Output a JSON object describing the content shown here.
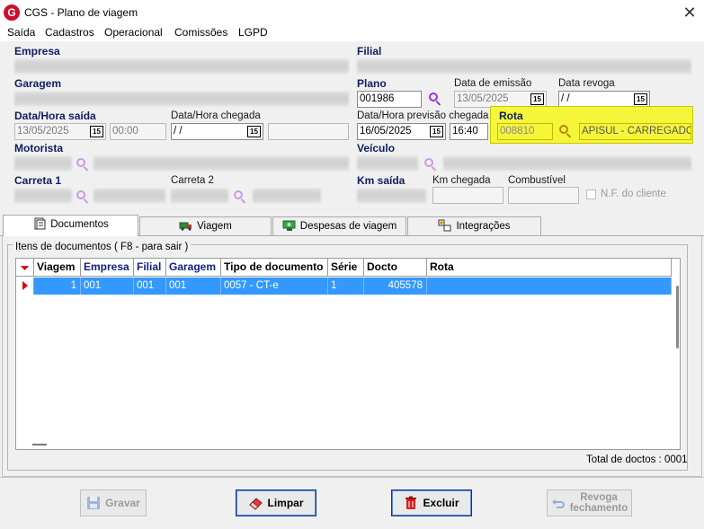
{
  "window": {
    "title": "CGS - Plano de viagem",
    "icon_letter": "G"
  },
  "menu": [
    "Saída",
    "Cadastros",
    "Operacional",
    "Comissões",
    "LGPD"
  ],
  "labels": {
    "empresa": "Empresa",
    "filial": "Filial",
    "garagem": "Garagem",
    "plano": "Plano",
    "data_emissao": "Data de emissão",
    "data_revoga": "Data revoga",
    "data_hora_saida": "Data/Hora saída",
    "data_hora_chegada": "Data/Hora chegada",
    "data_hora_previsao": "Data/Hora previsão chegada",
    "rota": "Rota",
    "motorista": "Motorista",
    "veiculo": "Veículo",
    "carreta1": "Carreta 1",
    "carreta2": "Carreta 2",
    "km_saida": "Km saída",
    "km_chegada": "Km chegada",
    "combustivel": "Combustível",
    "nf_cliente": "N.F. do cliente"
  },
  "fields": {
    "plano": "001986",
    "data_emissao": "13/05/2025",
    "data_revoga": " /  /",
    "saida_data": "13/05/2025",
    "saida_hora": "00:00",
    "chegada_data": " /  /",
    "previsao_data": "16/05/2025",
    "previsao_hora": "16:40",
    "rota_codigo": "008810",
    "rota_descricao": "APISUL - CARREGADO -"
  },
  "calendar_glyph": "15",
  "tabs": [
    "Documentos",
    "Viagem",
    "Despesas de viagem",
    "Integrações"
  ],
  "group_caption": "Itens de documentos ( F8 - para sair )",
  "table": {
    "columns": [
      "Viagem",
      "Empresa",
      "Filial",
      "Garagem",
      "Tipo de documento",
      "Série",
      "Docto",
      "Rota"
    ],
    "rows": [
      {
        "viagem": "1",
        "empresa": "001",
        "filial": "001",
        "garagem": "001",
        "tipo": "0057 - CT-e",
        "serie": "1",
        "docto": "405578",
        "rota": ""
      }
    ]
  },
  "total_text": "Total de doctos : 0001",
  "buttons": {
    "gravar": "Gravar",
    "limpar": "Limpar",
    "excluir": "Excluir",
    "revoga1": "Revoga",
    "revoga2": "fechamento"
  },
  "colors": {
    "selection": "#3399ff",
    "rota_highlight": "#f5f53a",
    "label_blue": "#102060",
    "search_icon": "#9b30d9",
    "brand_red": "#c8102e"
  }
}
